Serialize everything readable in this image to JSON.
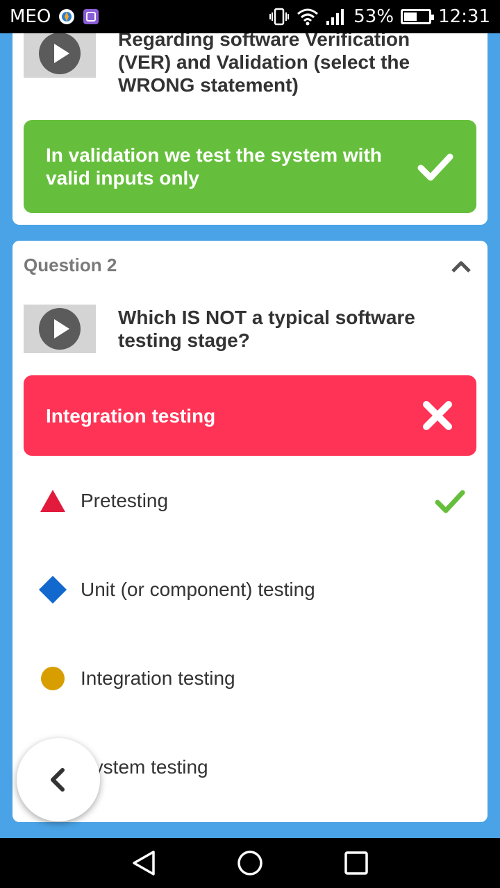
{
  "status_bar": {
    "carrier": "MEO",
    "battery": "53%",
    "time": "12:31",
    "icons": [
      "location-icon",
      "gallery-icon",
      "vibrate-icon",
      "wifi-icon",
      "signal-icon",
      "battery-icon"
    ]
  },
  "question1": {
    "text": "Regarding software Verification (VER) and Validation (select the WRONG statement)",
    "selected_answer": "In validation we test the system with valid inputs only",
    "result": "correct",
    "colors": {
      "correct": "#66bf3c"
    }
  },
  "question2": {
    "label": "Question 2",
    "text": "Which IS NOT a typical software testing stage?",
    "selected_answer": "Integration testing",
    "result": "wrong",
    "options": [
      {
        "shape": "triangle",
        "color": "#e21b3c",
        "label": "Pretesting",
        "correct": true
      },
      {
        "shape": "diamond",
        "color": "#1368ce",
        "label": "Unit (or component) testing",
        "correct": false
      },
      {
        "shape": "circle",
        "color": "#d89e00",
        "label": "Integration testing",
        "correct": false
      },
      {
        "shape": "square",
        "color": "#26890c",
        "label": "System testing",
        "correct": false
      }
    ],
    "colors": {
      "wrong": "#ff3355",
      "check": "#66bf3c"
    }
  },
  "nav": {
    "buttons": [
      "back-icon",
      "home-icon",
      "recents-icon"
    ]
  }
}
